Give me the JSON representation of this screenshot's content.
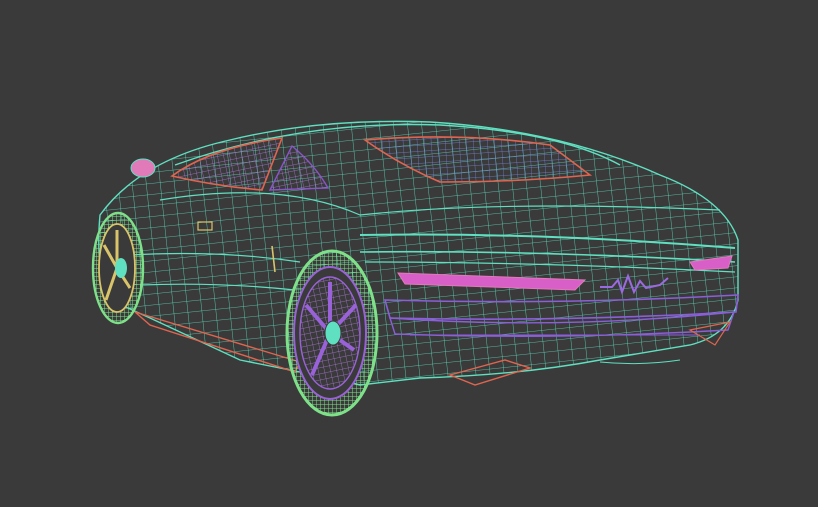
{
  "viewport": {
    "background": "#3a3a3a",
    "subject": "car-wireframe"
  },
  "palette": {
    "body_wire": "#5fe0c0",
    "tire_wire": "#7fe08a",
    "rim_purple": "#9a62d8",
    "rim_yellow": "#d9c46a",
    "glass_blue": "#6f7fd6",
    "glass_purple": "#8a55c8",
    "trim_red": "#e0654f",
    "taillight_pink": "#d85fc8",
    "bumper_purple": "#8a5fd8",
    "mirror_pink": "#e07ab8",
    "logo_purple": "#9a6ae0"
  }
}
